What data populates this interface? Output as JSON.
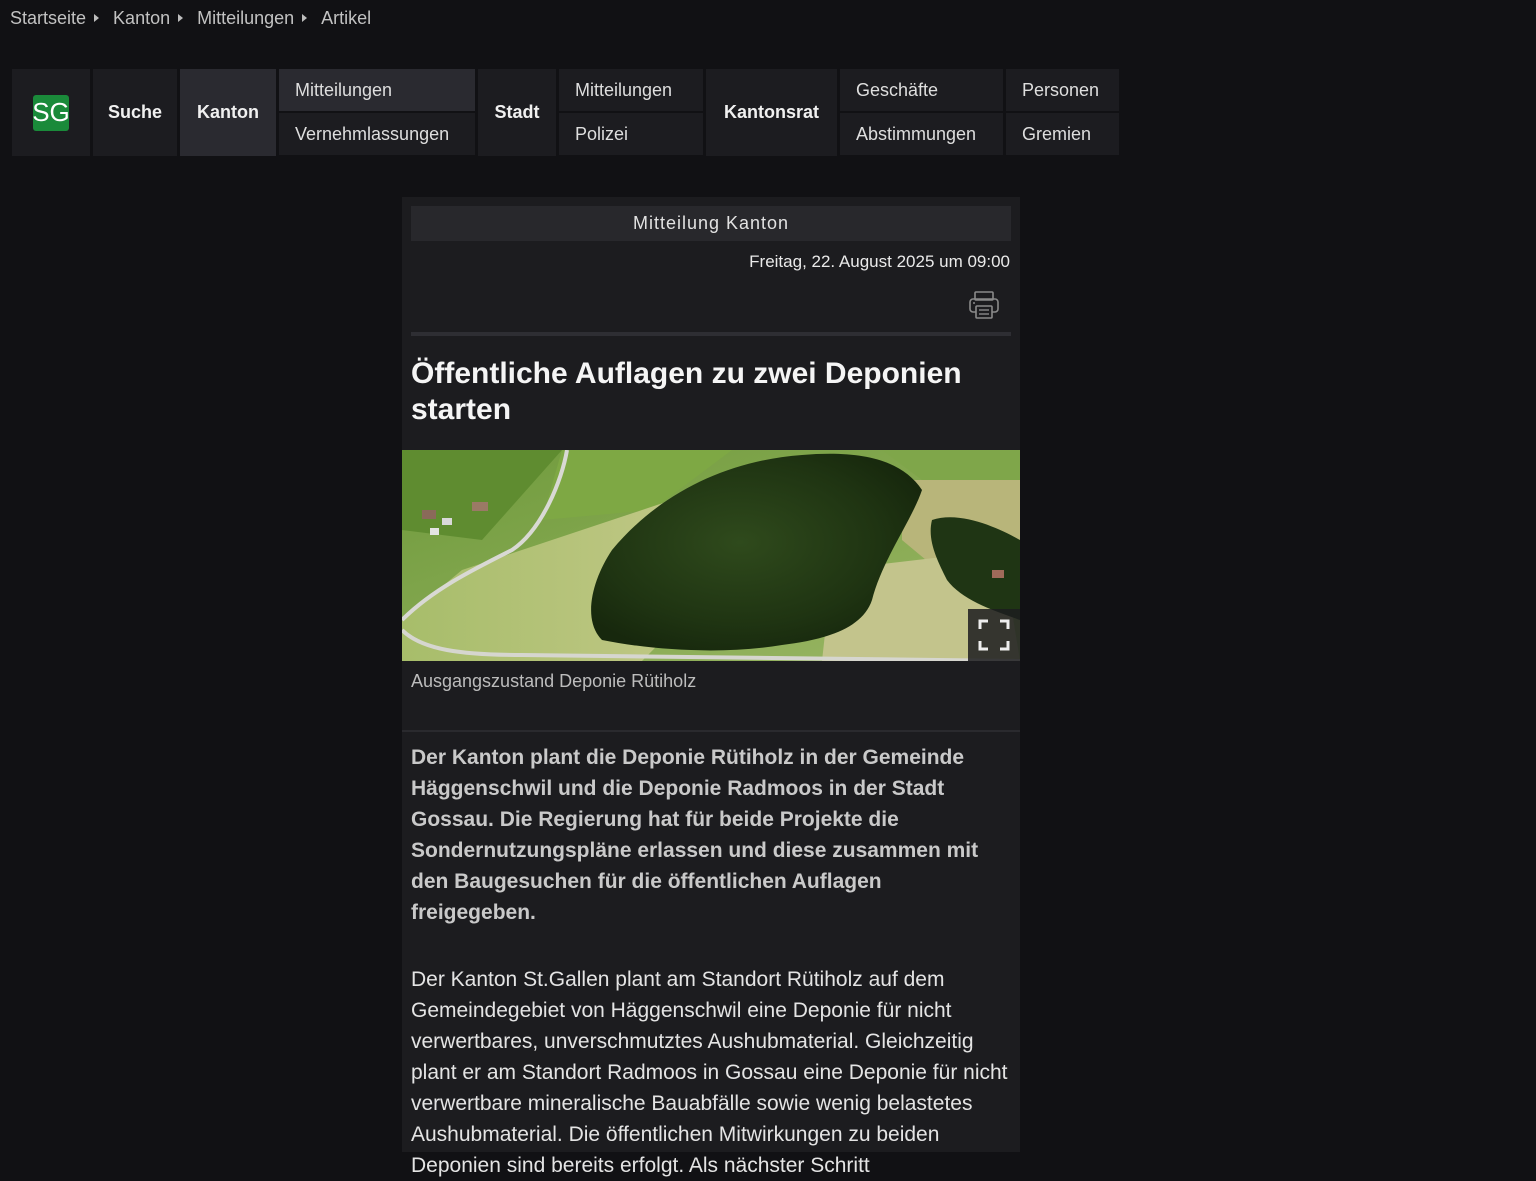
{
  "breadcrumb": {
    "items": [
      "Startseite",
      "Kanton",
      "Mitteilungen",
      "Artikel"
    ]
  },
  "nav": {
    "logo": "SG",
    "suche": "Suche",
    "kanton": "Kanton",
    "kanton_sub": [
      "Mitteilungen",
      "Vernehmlassungen"
    ],
    "stadt": "Stadt",
    "stadt_sub": [
      "Mitteilungen",
      "Polizei"
    ],
    "kantonsrat": "Kantonsrat",
    "kantonsrat_sub1": [
      "Geschäfte",
      "Abstimmungen"
    ],
    "kantonsrat_sub2": [
      "Personen",
      "Gremien"
    ]
  },
  "article": {
    "header": "Mitteilung Kanton",
    "date": "Freitag, 22. August 2025 um 09:00",
    "title": "Öffentliche Auflagen zu zwei Deponien starten",
    "image_caption": "Ausgangszustand Deponie Rütiholz",
    "lead": "Der Kanton plant die Deponie Rütiholz in der Gemeinde Häggenschwil und die Deponie Radmoos in der Stadt Gossau. Die Regierung hat für beide Projekte die Sondernutzungspläne erlassen und diese zusammen mit den Baugesuchen für die öffentlichen Auflagen freigegeben.",
    "body": "Der Kanton St.Gallen plant am Standort Rütiholz auf dem Gemeindegebiet von Häggenschwil eine Deponie für nicht verwertbares, unverschmutztes Aushubmaterial. Gleichzeitig plant er am Standort Radmoos in Gossau eine Deponie für nicht verwertbare mineralische Bauabfälle sowie wenig belastetes Aushubmaterial. Die öffentlichen Mitwirkungen zu beiden Deponien sind bereits erfolgt. Als nächster Schritt"
  },
  "icons": {
    "print": "printer-icon",
    "expand": "fullscreen-icon",
    "breadcrumb_separator": "triangle-right-icon"
  },
  "colors": {
    "background": "#111114",
    "panel": "#1c1c1f",
    "logo_green": "#1a8a3a"
  }
}
